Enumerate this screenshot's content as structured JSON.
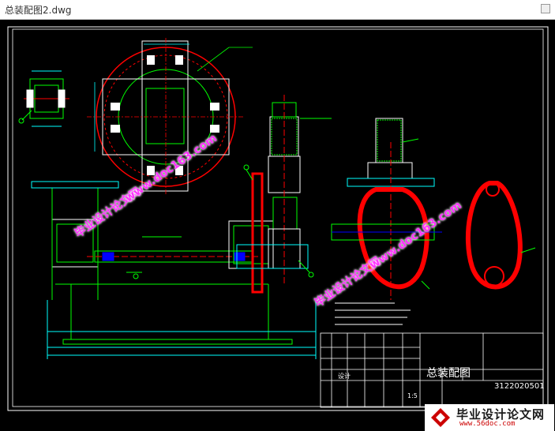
{
  "window": {
    "title": "总装配图2.dwg"
  },
  "drawing": {
    "title_block_title": "总装配图",
    "drawing_number": "3122020501",
    "scale": "1:5",
    "designer_label": "设计",
    "colors": {
      "background": "#000000",
      "frame": "#ffffff",
      "outline": "#00ff00",
      "dimension": "#00ffff",
      "center": "#ff0000",
      "annotation": "#ffff00",
      "hatch": "#0000ff"
    }
  },
  "watermarks": {
    "site": "www.doc163.com",
    "brand": "毕业设计论文网"
  },
  "logo": {
    "name": "毕业设计论文网",
    "url": "www.56doc.com"
  }
}
